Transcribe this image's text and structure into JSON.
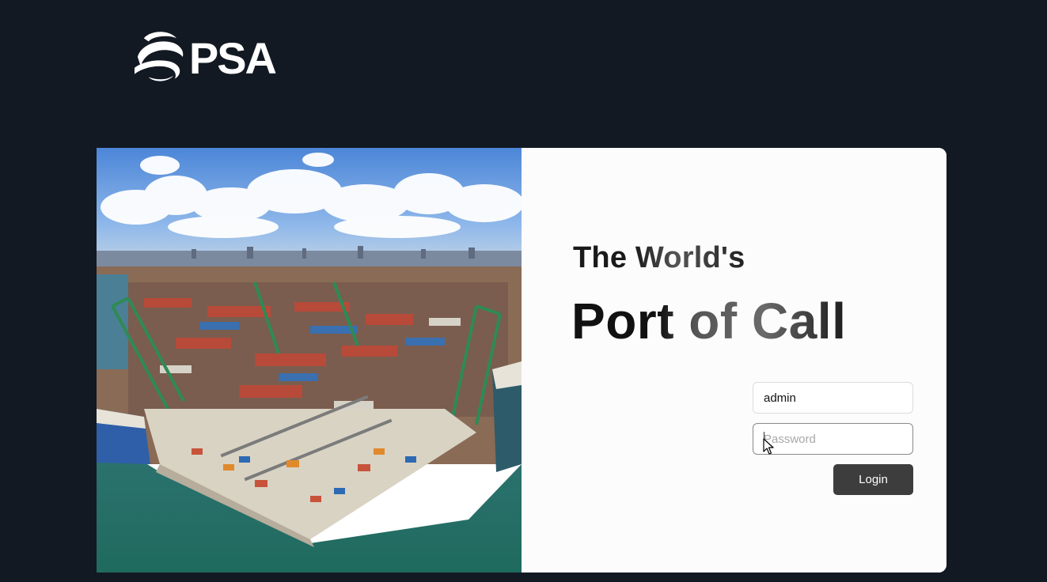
{
  "brand": {
    "logo_text": "PSA"
  },
  "hero": {
    "tagline_small": "The World's",
    "tagline_big": "Port of Call"
  },
  "login_form": {
    "username_value": "admin",
    "password_placeholder": "Password",
    "login_label": "Login"
  },
  "colors": {
    "page_background": "#131922",
    "card_background": "#fcfcfc",
    "button_background": "#3d3d3d",
    "button_text": "#ffffff"
  },
  "icons": {
    "logo_mark": "psa-swirl-logo",
    "cursor": "mouse-pointer"
  }
}
